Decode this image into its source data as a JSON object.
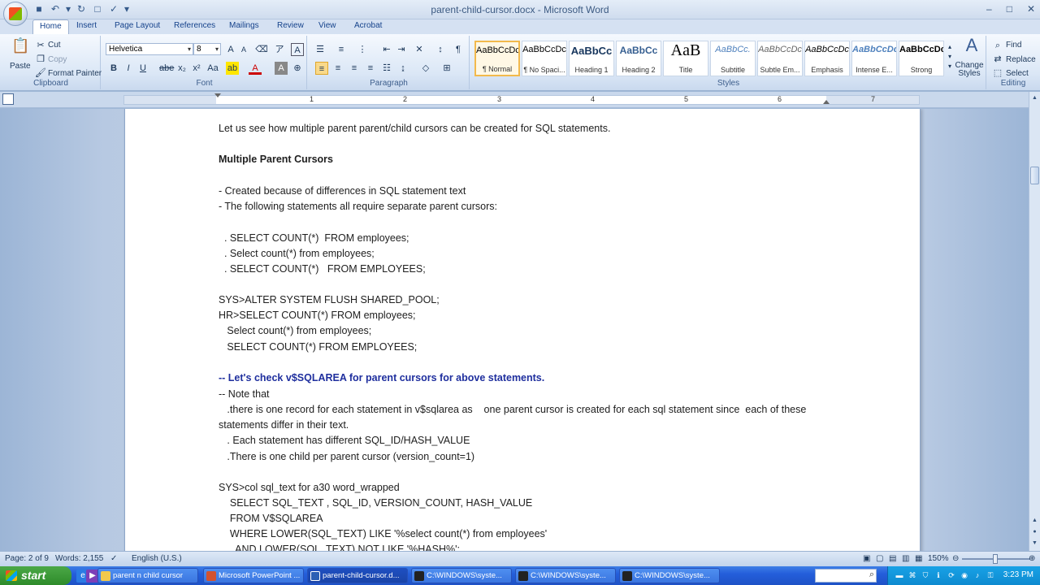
{
  "window": {
    "title": "parent-child-cursor.docx - Microsoft Word"
  },
  "tabs": [
    "Home",
    "Insert",
    "Page Layout",
    "References",
    "Mailings",
    "Review",
    "View",
    "Acrobat"
  ],
  "ribbon": {
    "clipboard": {
      "label": "Clipboard",
      "paste": "Paste",
      "cut": "Cut",
      "copy": "Copy",
      "format_painter": "Format Painter"
    },
    "font": {
      "label": "Font",
      "font_name": "Helvetica",
      "font_size": "8"
    },
    "paragraph": {
      "label": "Paragraph"
    },
    "styles": {
      "label": "Styles",
      "items": [
        {
          "sample": "AaBbCcDc",
          "name": "¶ Normal"
        },
        {
          "sample": "AaBbCcDc",
          "name": "¶ No Spaci..."
        },
        {
          "sample": "AaBbCc",
          "name": "Heading 1"
        },
        {
          "sample": "AaBbCc",
          "name": "Heading 2"
        },
        {
          "sample": "AaB",
          "name": "Title"
        },
        {
          "sample": "AaBbCc.",
          "name": "Subtitle"
        },
        {
          "sample": "AaBbCcDc",
          "name": "Subtle Em..."
        },
        {
          "sample": "AaBbCcDc",
          "name": "Emphasis"
        },
        {
          "sample": "AaBbCcDc",
          "name": "Intense E..."
        },
        {
          "sample": "AaBbCcDc",
          "name": "Strong"
        }
      ],
      "change_styles": "Change Styles"
    },
    "editing": {
      "label": "Editing",
      "find": "Find",
      "replace": "Replace",
      "select": "Select"
    }
  },
  "ruler": {
    "numbers": [
      "1",
      "2",
      "3",
      "4",
      "5",
      "6",
      "7"
    ]
  },
  "document": {
    "lines": [
      "Let us see how multiple parent parent/child cursors can be created for SQL statements.",
      "Multiple Parent Cursors",
      "- Created because of differences in SQL statement text",
      "- The following statements all require separate parent cursors:",
      "  . SELECT COUNT(*)  FROM employees;",
      "  . Select count(*) from employees;",
      "  . SELECT COUNT(*)   FROM EMPLOYEES;",
      "SYS>ALTER SYSTEM FLUSH SHARED_POOL;",
      "HR>SELECT COUNT(*) FROM employees;",
      "   Select count(*) from employees;",
      "   SELECT COUNT(*) FROM EMPLOYEES;",
      "-- Let's check v$SQLAREA for parent cursors for above statements.",
      "-- Note that",
      "   .there is one record for each statement in v$sqlarea as    one parent cursor is created for each sql statement since  each of these",
      "statements differ in their text.",
      "   . Each statement has different SQL_ID/HASH_VALUE",
      "   .There is one child per parent cursor (version_count=1)",
      "SYS>col sql_text for a30 word_wrapped",
      "    SELECT SQL_TEXT , SQL_ID, VERSION_COUNT, HASH_VALUE",
      "    FROM V$SQLAREA",
      "    WHERE LOWER(SQL_TEXT) LIKE '%select count(*) from employees'",
      "      AND LOWER(SQL_TEXT) NOT LIKE '%HASH%';"
    ]
  },
  "statusbar": {
    "page": "Page: 2 of 9",
    "words": "Words: 2,155",
    "language": "English (U.S.)",
    "zoom": "150%"
  },
  "taskbar": {
    "start": "start",
    "tasks": [
      {
        "label": "parent n child cursor",
        "color": "#f2c94c"
      },
      {
        "label": "Microsoft PowerPoint ...",
        "color": "#d35230"
      },
      {
        "label": "parent-child-cursor.d...",
        "color": "#2b5fb4"
      },
      {
        "label": "C:\\WINDOWS\\syste...",
        "color": "#222222"
      },
      {
        "label": "C:\\WINDOWS\\syste...",
        "color": "#222222"
      },
      {
        "label": "C:\\WINDOWS\\syste...",
        "color": "#222222"
      }
    ],
    "clock": "3:23 PM"
  }
}
